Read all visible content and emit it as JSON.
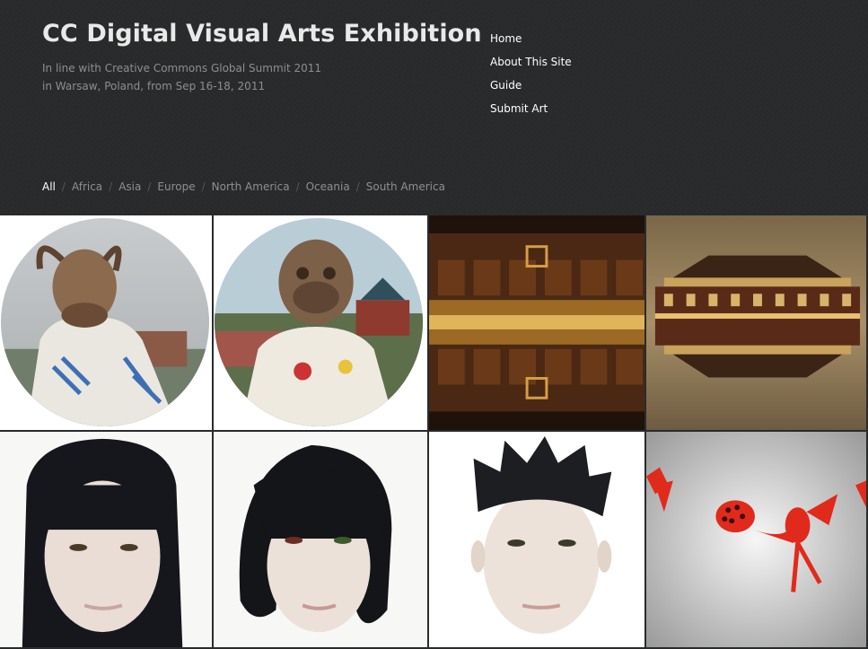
{
  "site": {
    "title": "CC Digital Visual Arts Exhibition",
    "tagline_line1": "In line with Creative Commons Global Summit 2011",
    "tagline_line2": "in Warsaw, Poland, from Sep 16-18, 2011"
  },
  "nav": {
    "home": "Home",
    "about": "About This Site",
    "guide": "Guide",
    "submit": "Submit Art"
  },
  "filters": {
    "all": "All",
    "africa": "Africa",
    "asia": "Asia",
    "europe": "Europe",
    "north_america": "North America",
    "oceania": "Oceania",
    "south_america": "South America",
    "separator": "/"
  },
  "gallery": {
    "tiles": [
      {
        "subject": "goat-head astronaut"
      },
      {
        "subject": "monkey-head astronaut"
      },
      {
        "subject": "mirrored palace interior"
      },
      {
        "subject": "mirrored palace reflection"
      },
      {
        "subject": "portrait long black hair"
      },
      {
        "subject": "portrait bob haircut"
      },
      {
        "subject": "portrait spiky hair"
      },
      {
        "subject": "red creatures illustration"
      }
    ]
  },
  "colors": {
    "background": "#2a2b2c",
    "title": "#e9e9e9",
    "muted": "#8e8e8e",
    "link": "#ffffff"
  }
}
